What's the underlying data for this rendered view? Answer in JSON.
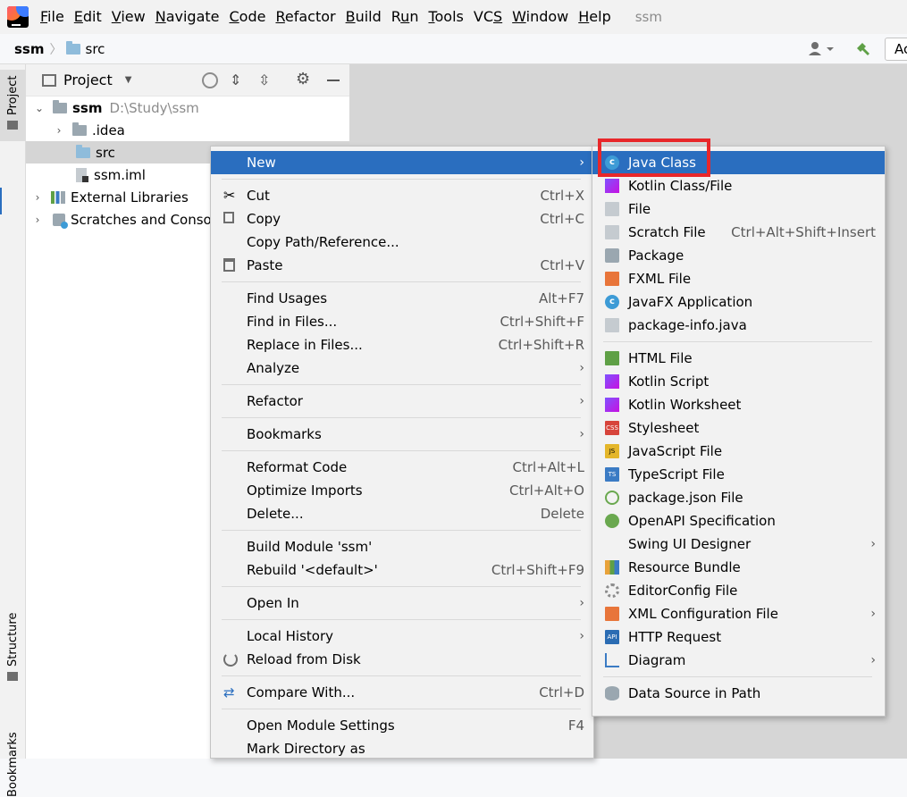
{
  "menubar": {
    "items": [
      {
        "pre": "",
        "u": "F",
        "post": "ile"
      },
      {
        "pre": "",
        "u": "E",
        "post": "dit"
      },
      {
        "pre": "",
        "u": "V",
        "post": "iew"
      },
      {
        "pre": "",
        "u": "N",
        "post": "avigate"
      },
      {
        "pre": "",
        "u": "C",
        "post": "ode"
      },
      {
        "pre": "",
        "u": "R",
        "post": "efactor"
      },
      {
        "pre": "",
        "u": "B",
        "post": "uild"
      },
      {
        "pre": "R",
        "u": "u",
        "post": "n"
      },
      {
        "pre": "",
        "u": "T",
        "post": "ools"
      },
      {
        "pre": "VC",
        "u": "S",
        "post": ""
      },
      {
        "pre": "",
        "u": "W",
        "post": "indow"
      },
      {
        "pre": "",
        "u": "H",
        "post": "elp"
      }
    ],
    "project_name": "ssm"
  },
  "navbar": {
    "crumb_project": "ssm",
    "crumb_folder": "src",
    "run_config_label": "Ac"
  },
  "stripe": {
    "project": "Project",
    "structure": "Structure",
    "bookmarks": "Bookmarks"
  },
  "project_panel": {
    "title": "Project",
    "tree": {
      "root": "ssm",
      "root_path": "D:\\Study\\ssm",
      "idea": ".idea",
      "src": "src",
      "iml": "ssm.iml",
      "ext_libs": "External Libraries",
      "scratches": "Scratches and Consoles"
    }
  },
  "context_menu": {
    "new": "New",
    "cut": "Cut",
    "cut_sc": "Ctrl+X",
    "copy": "Copy",
    "copy_sc": "Ctrl+C",
    "copy_path": "Copy Path/Reference...",
    "paste": "Paste",
    "paste_sc": "Ctrl+V",
    "find_usages": "Find Usages",
    "find_usages_sc": "Alt+F7",
    "find_in_files": "Find in Files...",
    "find_in_files_sc": "Ctrl+Shift+F",
    "replace_in_files": "Replace in Files...",
    "replace_in_files_sc": "Ctrl+Shift+R",
    "analyze": "Analyze",
    "refactor": "Refactor",
    "bookmarks": "Bookmarks",
    "reformat": "Reformat Code",
    "reformat_sc": "Ctrl+Alt+L",
    "optimize": "Optimize Imports",
    "optimize_sc": "Ctrl+Alt+O",
    "delete": "Delete...",
    "delete_sc": "Delete",
    "build_module": "Build Module 'ssm'",
    "rebuild": "Rebuild '<default>'",
    "rebuild_sc": "Ctrl+Shift+F9",
    "open_in": "Open In",
    "local_history": "Local History",
    "reload": "Reload from Disk",
    "compare": "Compare With...",
    "compare_sc": "Ctrl+D",
    "module_settings": "Open Module Settings",
    "module_settings_sc": "F4",
    "mark_dir": "Mark Directory as"
  },
  "submenu": {
    "java_class": "Java Class",
    "kotlin_class": "Kotlin Class/File",
    "file": "File",
    "scratch": "Scratch File",
    "scratch_sc": "Ctrl+Alt+Shift+Insert",
    "package": "Package",
    "fxml": "FXML File",
    "javafx": "JavaFX Application",
    "pkg_info": "package-info.java",
    "html": "HTML File",
    "kotlin_script": "Kotlin Script",
    "kotlin_ws": "Kotlin Worksheet",
    "stylesheet": "Stylesheet",
    "js": "JavaScript File",
    "ts": "TypeScript File",
    "pkg_json": "package.json File",
    "openapi": "OpenAPI Specification",
    "swing": "Swing UI Designer",
    "bundle": "Resource Bundle",
    "editorconfig": "EditorConfig File",
    "xml_config": "XML Configuration File",
    "http": "HTTP Request",
    "diagram": "Diagram",
    "datasource": "Data Source in Path"
  }
}
